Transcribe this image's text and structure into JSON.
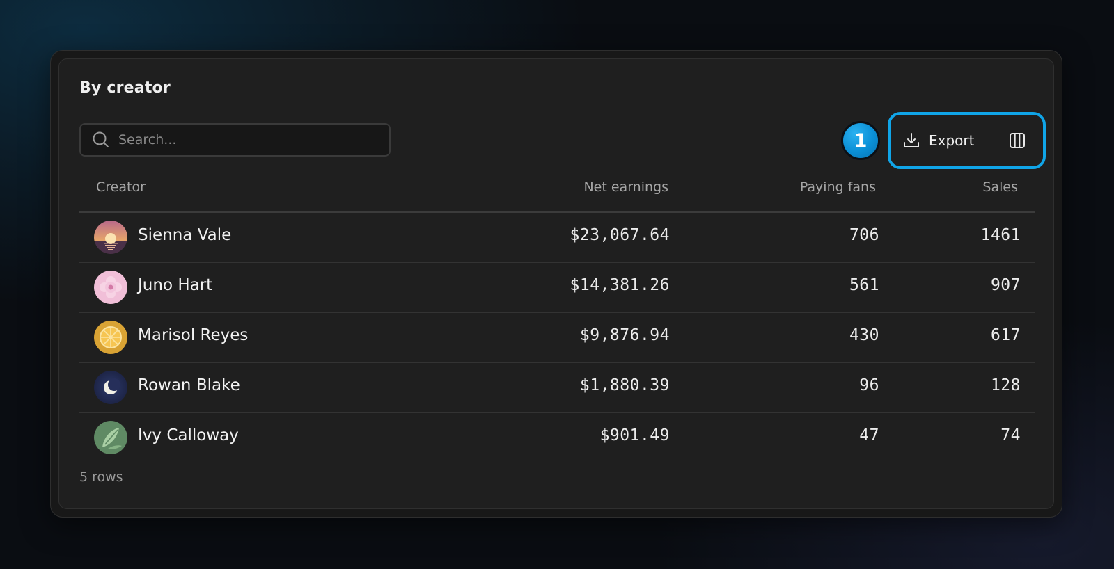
{
  "panel": {
    "title": "By creator"
  },
  "search": {
    "placeholder": "Search..."
  },
  "step_badge": "1",
  "toolbar": {
    "export_label": "Export"
  },
  "table": {
    "columns": [
      "Creator",
      "Net earnings",
      "Paying fans",
      "Sales"
    ],
    "rows": [
      {
        "name": "Sienna Vale",
        "net": "$23,067.64",
        "fans": "706",
        "sales": "1461",
        "avatar": "sunset-avatar"
      },
      {
        "name": "Juno Hart",
        "net": "$14,381.26",
        "fans": "561",
        "sales": "907",
        "avatar": "flower-avatar"
      },
      {
        "name": "Marisol Reyes",
        "net": "$9,876.94",
        "fans": "430",
        "sales": "617",
        "avatar": "citrus-avatar"
      },
      {
        "name": "Rowan Blake",
        "net": "$1,880.39",
        "fans": "96",
        "sales": "128",
        "avatar": "moon-avatar"
      },
      {
        "name": "Ivy Calloway",
        "net": "$901.49",
        "fans": "47",
        "sales": "74",
        "avatar": "leaf-avatar"
      }
    ]
  },
  "footer": {
    "row_count": "5 rows"
  },
  "colors": {
    "accent": "#10a5e8",
    "panel_bg": "#1f1f1f",
    "page_bg": "#0a0d12"
  },
  "icons": [
    "search-icon",
    "download-icon",
    "columns-icon"
  ]
}
